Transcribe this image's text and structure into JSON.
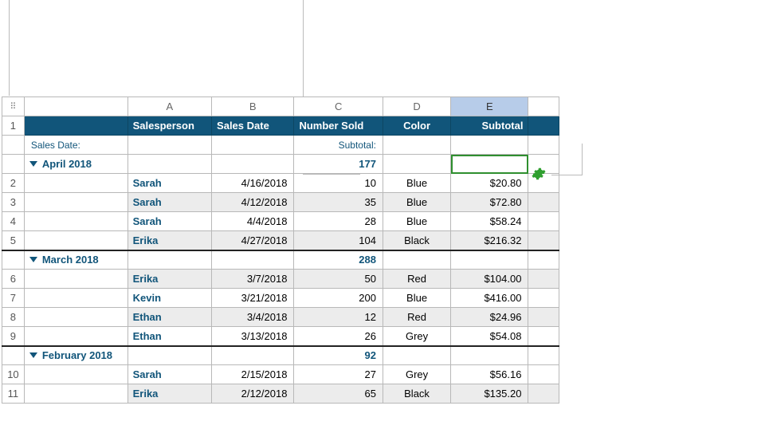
{
  "columns": {
    "corner_glyph": "⠿",
    "A": "A",
    "B": "B",
    "C": "C",
    "D": "D",
    "E": "E"
  },
  "headers": {
    "group": "",
    "A": "Salesperson",
    "B": "Sales Date",
    "C": "Number Sold",
    "D": "Color",
    "E": "Subtotal"
  },
  "summary_labels": {
    "group": "Sales Date:",
    "C": "Subtotal:"
  },
  "groups": [
    {
      "label": "April 2018",
      "total_c": "177",
      "selected_e": true,
      "rows": [
        {
          "n": "2",
          "a": "Sarah",
          "b": "4/16/2018",
          "c": "10",
          "d": "Blue",
          "e": "$20.80",
          "alt": false
        },
        {
          "n": "3",
          "a": "Sarah",
          "b": "4/12/2018",
          "c": "35",
          "d": "Blue",
          "e": "$72.80",
          "alt": true
        },
        {
          "n": "4",
          "a": "Sarah",
          "b": "4/4/2018",
          "c": "28",
          "d": "Blue",
          "e": "$58.24",
          "alt": false
        },
        {
          "n": "5",
          "a": "Erika",
          "b": "4/27/2018",
          "c": "104",
          "d": "Black",
          "e": "$216.32",
          "alt": true
        }
      ]
    },
    {
      "label": "March 2018",
      "total_c": "288",
      "rows": [
        {
          "n": "6",
          "a": "Erika",
          "b": "3/7/2018",
          "c": "50",
          "d": "Red",
          "e": "$104.00",
          "alt": true
        },
        {
          "n": "7",
          "a": "Kevin",
          "b": "3/21/2018",
          "c": "200",
          "d": "Blue",
          "e": "$416.00",
          "alt": false
        },
        {
          "n": "8",
          "a": "Ethan",
          "b": "3/4/2018",
          "c": "12",
          "d": "Red",
          "e": "$24.96",
          "alt": true
        },
        {
          "n": "9",
          "a": "Ethan",
          "b": "3/13/2018",
          "c": "26",
          "d": "Grey",
          "e": "$54.08",
          "alt": false
        }
      ]
    },
    {
      "label": "February 2018",
      "total_c": "92",
      "rows": [
        {
          "n": "10",
          "a": "Sarah",
          "b": "2/15/2018",
          "c": "27",
          "d": "Grey",
          "e": "$56.16",
          "alt": false
        },
        {
          "n": "11",
          "a": "Erika",
          "b": "2/12/2018",
          "c": "65",
          "d": "Black",
          "e": "$135.20",
          "alt": true
        }
      ]
    }
  ],
  "row1_num": "1"
}
